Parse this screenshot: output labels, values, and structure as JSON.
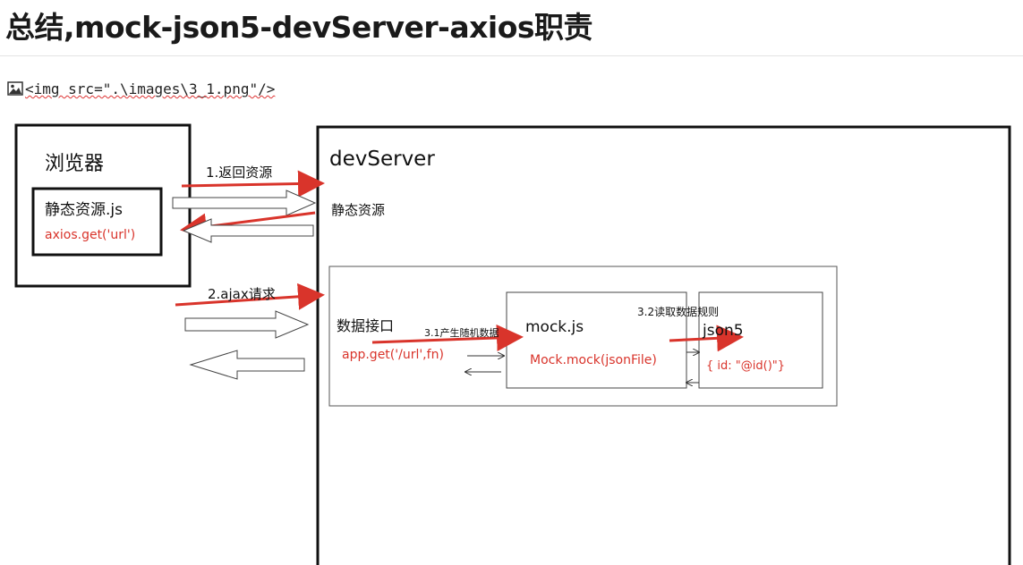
{
  "title": "总结,mock-json5-devServer-axios职责",
  "img_line": {
    "icon": "image-icon",
    "code": "<img src=\".\\images\\3_1.png\"/>"
  },
  "diagram": {
    "browser": {
      "label": "浏览器",
      "static_js": "静态资源.js",
      "axios_call": "axios.get('url')"
    },
    "devserver": {
      "label": "devServer",
      "static_res": "静态资源",
      "data_api": "数据接口",
      "app_get": "app.get('/url',fn)"
    },
    "mock": {
      "label": "mock.js",
      "call": "Mock.mock(jsonFile)"
    },
    "json5": {
      "label": "json5",
      "rule": "{ id: \"@id()\"}"
    },
    "steps": {
      "s1": "1.返回资源",
      "s2": "2.ajax请求",
      "s31": "3.1产生随机数据",
      "s32": "3.2读取数据规则"
    },
    "colors": {
      "accent": "#d9342b",
      "border": "#111111"
    }
  }
}
